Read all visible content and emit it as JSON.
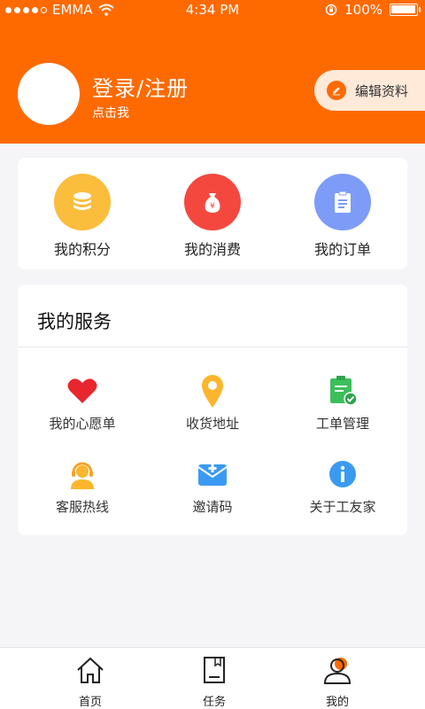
{
  "status_bar": {
    "carrier": "EMMA",
    "time": "4:34 PM",
    "battery": "100%",
    "battery_level": 1.0
  },
  "profile": {
    "title": "登录/注册",
    "subtitle": "点击我",
    "edit_label": "编辑资料"
  },
  "stats": [
    {
      "label": "我的积分",
      "icon": "coins-icon",
      "color": "#fbbd3c"
    },
    {
      "label": "我的消费",
      "icon": "money-bag-icon",
      "color": "#f4483f"
    },
    {
      "label": "我的订单",
      "icon": "clipboard-icon",
      "color": "#7d9cf7"
    }
  ],
  "services": {
    "title": "我的服务",
    "items": [
      {
        "label": "我的心愿单",
        "icon": "heart-icon"
      },
      {
        "label": "收货地址",
        "icon": "location-pin-icon"
      },
      {
        "label": "工单管理",
        "icon": "checklist-icon"
      },
      {
        "label": "客服热线",
        "icon": "customer-service-icon"
      },
      {
        "label": "邀请码",
        "icon": "envelope-icon"
      },
      {
        "label": "关于工友家",
        "icon": "info-icon"
      }
    ]
  },
  "bottom_nav": [
    {
      "label": "首页",
      "icon": "home-icon"
    },
    {
      "label": "任务",
      "icon": "task-icon"
    },
    {
      "label": "我的",
      "icon": "profile-icon",
      "active": true
    }
  ],
  "colors": {
    "brand": "#ff6a00"
  }
}
